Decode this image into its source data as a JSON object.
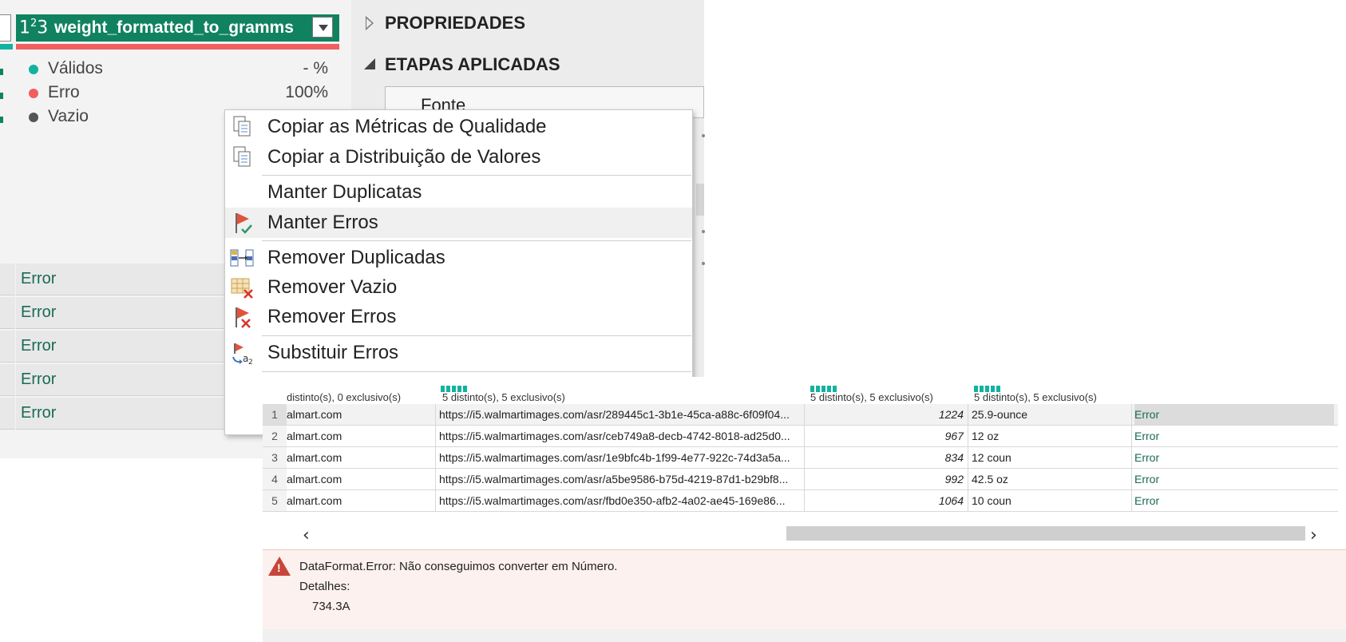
{
  "column_header": {
    "type_icon": "123",
    "name": "weight_formatted_to_gramms"
  },
  "quality": [
    {
      "label": "Válidos",
      "value": "- %",
      "color": "#11b3a0"
    },
    {
      "label": "Erro",
      "value": "100%",
      "color": "#f25e5e"
    },
    {
      "label": "Vazio",
      "value": "",
      "color": "#555555"
    }
  ],
  "left_cells": [
    "Error",
    "Error",
    "Error",
    "Error",
    "Error"
  ],
  "settings": {
    "properties": "PROPRIEDADES",
    "applied_steps": "ETAPAS APLICADAS",
    "first_step": "Fonte"
  },
  "context_menu": {
    "items": [
      {
        "label": "Copiar as Métricas de Qualidade",
        "icon": "copy-icon"
      },
      {
        "label": "Copiar a Distribuição de Valores",
        "icon": "copy-icon"
      },
      {
        "label": "Manter Duplicatas",
        "icon": ""
      },
      {
        "label": "Manter Erros",
        "icon": "keep-errors-icon"
      },
      {
        "label": "Remover Duplicadas",
        "icon": "remove-duplicates-icon"
      },
      {
        "label": "Remover Vazio",
        "icon": "remove-empty-icon"
      },
      {
        "label": "Remover Erros",
        "icon": "remove-errors-icon"
      },
      {
        "label": "Substituir Erros",
        "icon": "replace-errors-icon"
      }
    ]
  },
  "grid": {
    "stats": [
      "distinto(s), 0 exclusivo(s)",
      "5 distinto(s), 5 exclusivo(s)",
      "5 distinto(s), 5 exclusivo(s)",
      "5 distinto(s), 5 exclusivo(s)"
    ],
    "rows": [
      {
        "n": "1",
        "site": "almart.com",
        "url": "https://i5.walmartimages.com/asr/289445c1-3b1e-45ca-a88c-6f09f04...",
        "num": "1224",
        "weight": "25.9-ounce",
        "result": "Error"
      },
      {
        "n": "2",
        "site": "almart.com",
        "url": "https://i5.walmartimages.com/asr/ceb749a8-decb-4742-8018-ad25d0...",
        "num": "967",
        "weight": "12 oz",
        "result": "Error"
      },
      {
        "n": "3",
        "site": "almart.com",
        "url": "https://i5.walmartimages.com/asr/1e9bfc4b-1f99-4e77-922c-74d3a5a...",
        "num": "834",
        "weight": "12 coun",
        "result": "Error"
      },
      {
        "n": "4",
        "site": "almart.com",
        "url": "https://i5.walmartimages.com/asr/a5be9586-b75d-4219-87d1-b29bf8...",
        "num": "992",
        "weight": "42.5 oz",
        "result": "Error"
      },
      {
        "n": "5",
        "site": "almart.com",
        "url": "https://i5.walmartimages.com/asr/fbd0e350-afb2-4a02-ae45-169e86...",
        "num": "1064",
        "weight": "10 coun",
        "result": "Error"
      }
    ],
    "error": {
      "message": "DataFormat.Error: Não conseguimos converter em Número.",
      "details_label": "Detalhes:",
      "details_value": "734.3A"
    }
  }
}
